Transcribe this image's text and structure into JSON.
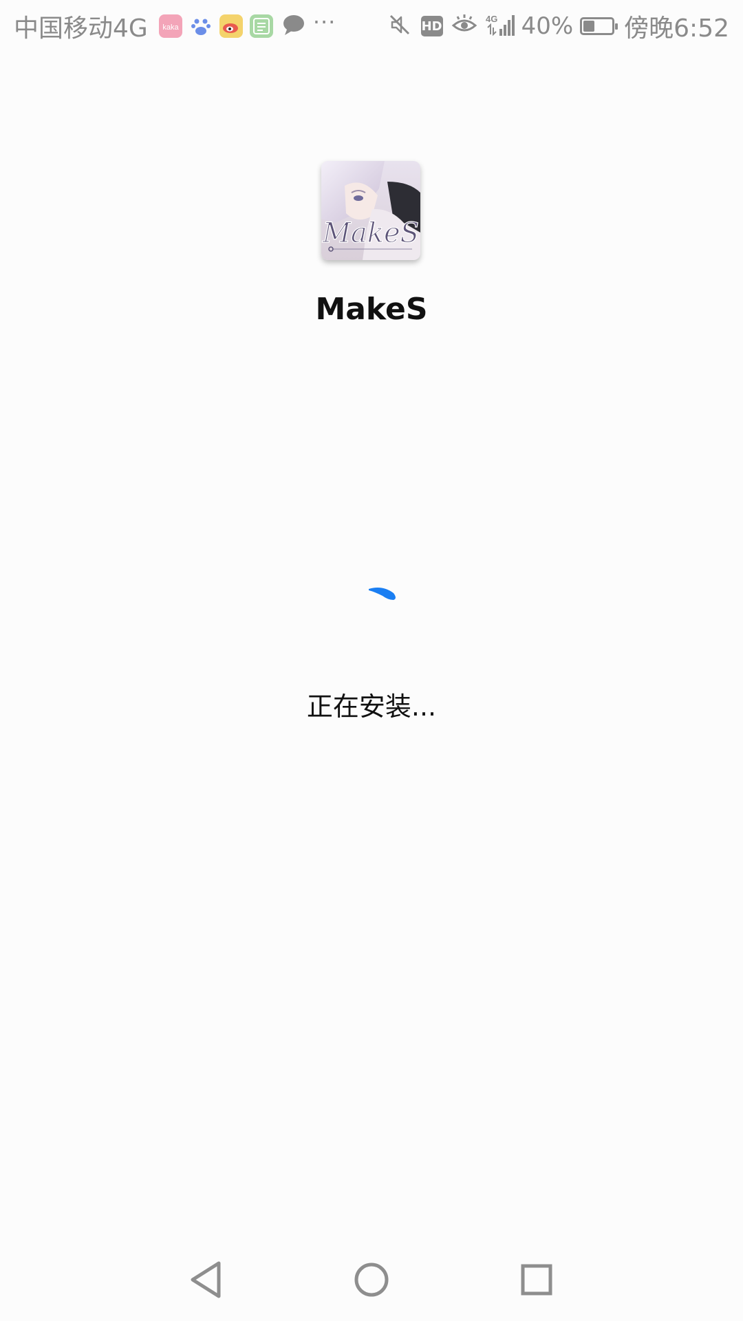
{
  "status_bar": {
    "carrier": "中国移动4G",
    "more": "···",
    "hd_label": "HD",
    "network": "4G",
    "battery_percent": "40%",
    "battery_level": 0.4,
    "time": "傍晚6:52",
    "notification_icons": [
      "kaka-app-icon",
      "baidu-paw-icon",
      "weibo-icon",
      "qutoutiao-icon",
      "message-bubble-icon"
    ],
    "status_icons": [
      "mute-icon",
      "hd-icon",
      "eye-protection-icon",
      "signal-icon",
      "battery-icon"
    ]
  },
  "installer": {
    "app_name": "MakeS",
    "status_text": "正在安装...",
    "spinner_color": "#1a7ef2"
  },
  "nav_bar": {
    "buttons": [
      "back",
      "home",
      "recents"
    ]
  }
}
